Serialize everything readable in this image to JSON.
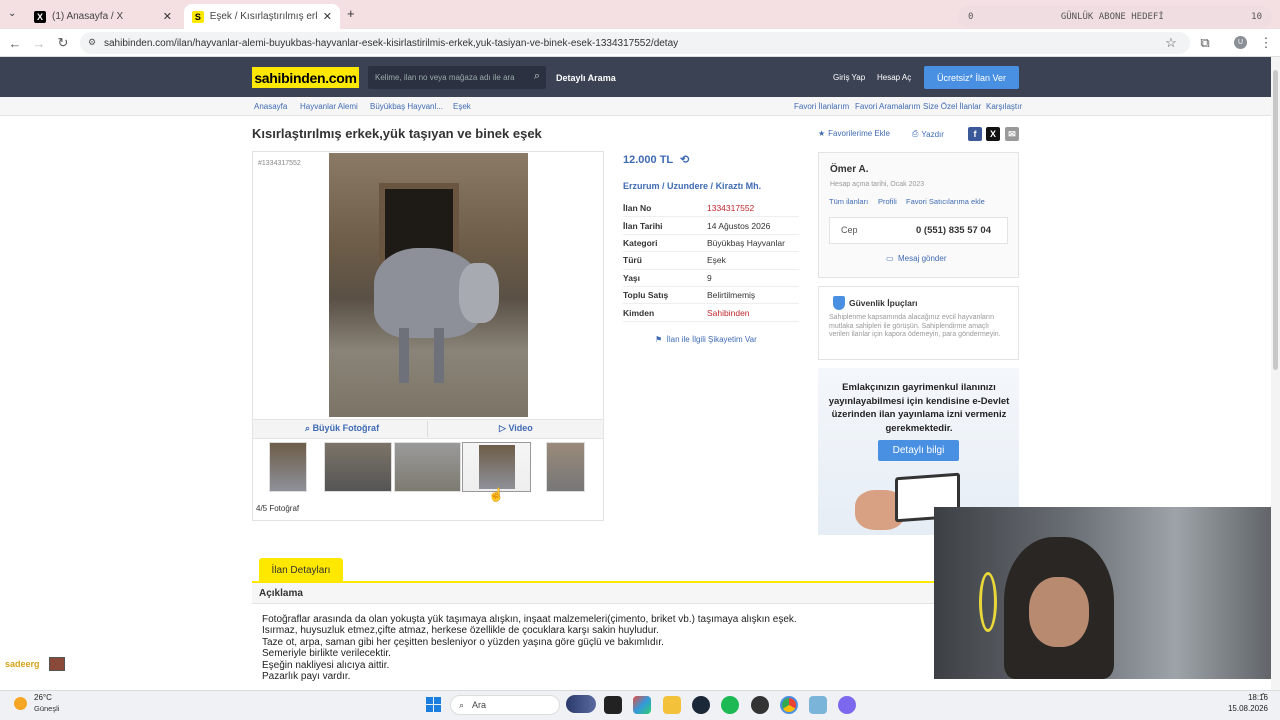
{
  "browser": {
    "tabs": [
      {
        "label": "(1) Anasayfa / X",
        "icon": "x-logo-icon"
      },
      {
        "label": "Eşek / Kısırlaştırılmış erkek,yük t",
        "icon": "sahibinden-favicon"
      }
    ],
    "new_tab": "+",
    "url": "sahibinden.com/ilan/hayvanlar-alemi-buyukbas-hayvanlar-esek-kisirlastirilmis-erkek,yuk-tasiyan-ve-binek-esek-1334317552/detay",
    "profile_initial": "U"
  },
  "overlay": {
    "subscriber_count": "0",
    "subscriber_goal": "GÜNLÜK ABONE HEDEFİ",
    "subscriber_target": "10"
  },
  "site": {
    "logo": "sahibinden.com",
    "search_placeholder": "Kelime, ilan no veya mağaza adı ile ara",
    "detailed_search": "Detaylı Arama",
    "login": "Giriş Yap",
    "register": "Hesap Aç",
    "post_ad": "Ücretsiz* İlan Ver"
  },
  "breadcrumb": {
    "items": [
      "Anasayfa",
      "Hayvanlar Alemi",
      "Büyükbaş Hayvanl...",
      "Eşek"
    ],
    "right": [
      "Favori İlanlarım",
      "Favori Aramalarım",
      "Size Özel İlanlar",
      "Karşılaştır"
    ]
  },
  "listing": {
    "title": "Kısırlaştırılmış erkek,yük taşıyan ve binek eşek",
    "add_favorite": "Favorilerime Ekle",
    "print": "Yazdır",
    "ad_number_tag": "#1334317552",
    "price": "12.000 TL",
    "location": [
      "Erzurum",
      "Uzundere",
      "Kiraztı Mh."
    ],
    "gallery_large": "Büyük Fotoğraf",
    "gallery_video": "Video",
    "photo_count": "4/5 Fotoğraf",
    "complaint": "İlan ile İlgili Şikayetim Var",
    "info": [
      {
        "k": "İlan No",
        "v": "1334317552"
      },
      {
        "k": "İlan Tarihi",
        "v": "14 Ağustos 2026"
      },
      {
        "k": "Kategori",
        "v": "Büyükbaş Hayvanlar"
      },
      {
        "k": "Türü",
        "v": "Eşek"
      },
      {
        "k": "Yaşı",
        "v": "9"
      },
      {
        "k": "Toplu Satış",
        "v": "Belirtilmemiş"
      },
      {
        "k": "Kimden",
        "v": "Sahibinden"
      }
    ]
  },
  "seller": {
    "name": "Ömer A.",
    "since": "Hesap açma tarihi, Ocak 2023",
    "links": [
      "Tüm ilanları",
      "Profili",
      "Favori Satıcılarıma ekle"
    ],
    "phone_label": "Cep",
    "phone": "0 (551) 835 57 04",
    "message": "Mesaj gönder"
  },
  "security": {
    "title": "Güvenlik İpuçları",
    "text": "Sahiplenme kapsamında alacağınız evcil hayvanların mutlaka sahipleri ile görüşün. Sahiplendirme amaçlı verilen ilanlar için kapora ödemeyin, para göndermeyin."
  },
  "banner": {
    "text": "Emlakçınızın gayrimenkul ilanınızı yayınlayabilmesi için kendisine e-Devlet üzerinden ilan yayınlama izni vermeniz gerekmektedir.",
    "button": "Detaylı bilgi"
  },
  "details": {
    "tab": "İlan Detayları",
    "heading": "Açıklama",
    "lines": [
      "Fotoğraflar arasında da olan yokuşta yük taşımaya alışkın, inşaat malzemeleri(çimento, briket vb.) taşımaya alışkın eşek.",
      "Isırmaz, huysuzluk etmez,çifte atmaz, herkese özellikle de çocuklara karşı sakin huyludur.",
      "Taze ot, arpa, saman gibi her çeşitten besleniyor o yüzden yaşına göre güçlü ve bakımlıdır.",
      "Semeriyle birlikte verilecektir.",
      "Eşeğin nakliyesi alıcıya aittir.",
      "Pazarlık payı vardır."
    ]
  },
  "chat": {
    "user": "sadeerg",
    "sep": ":"
  },
  "taskbar": {
    "temp": "26°C",
    "weather": "Güneşli",
    "search": "Ara",
    "time": "18:16",
    "date": "15.08.2026"
  },
  "colors": {
    "brand_yellow": "#ffe800",
    "header": "#3a4254",
    "link": "#3f6bb3",
    "accent": "#4a90e2",
    "red": "#c0272d"
  }
}
